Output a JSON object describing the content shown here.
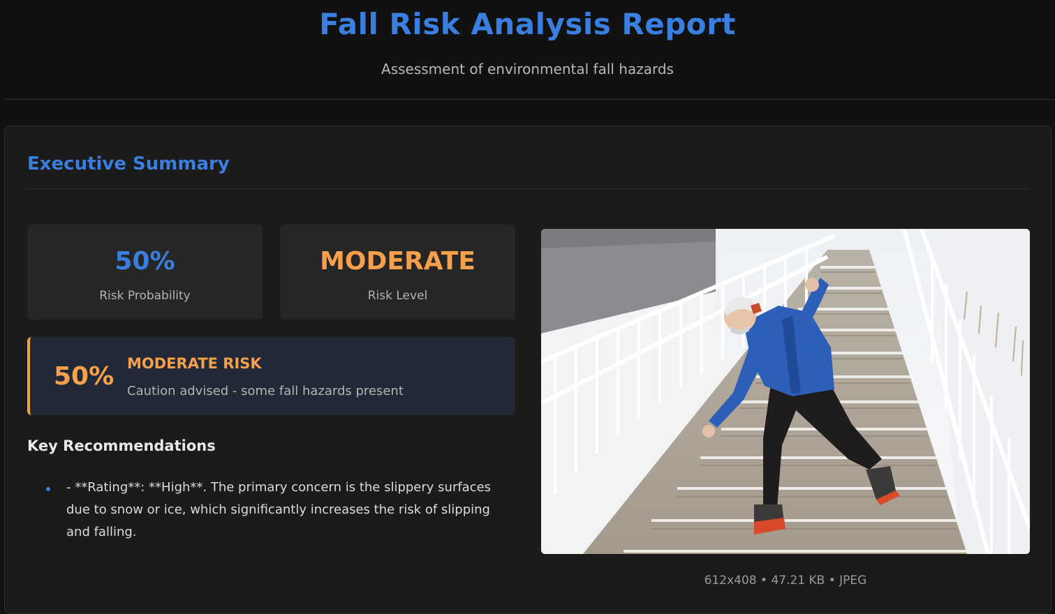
{
  "header": {
    "title": "Fall Risk Analysis Report",
    "subtitle": "Assessment of environmental fall hazards"
  },
  "summary": {
    "title": "Executive Summary",
    "probability": {
      "value": "50%",
      "label": "Risk Probability"
    },
    "level": {
      "value": "MODERATE",
      "label": "Risk Level"
    },
    "banner": {
      "percent": "50%",
      "title": "MODERATE RISK",
      "description": "Caution advised - some fall hazards present"
    },
    "recommendations": {
      "heading": "Key Recommendations",
      "items": [
        "- **Rating**: **High**. The primary concern is the slippery surfaces due to snow or ice, which significantly increases the risk of slipping and falling."
      ]
    },
    "image": {
      "meta": "612x408 • 47.21 KB • JPEG"
    }
  },
  "colors": {
    "accent_blue": "#3a7ee0",
    "accent_orange": "#f6a04d",
    "background": "#111111",
    "panel": "#1b1b1b"
  },
  "icons": {
    "bullet": "dot-bullet-icon"
  }
}
